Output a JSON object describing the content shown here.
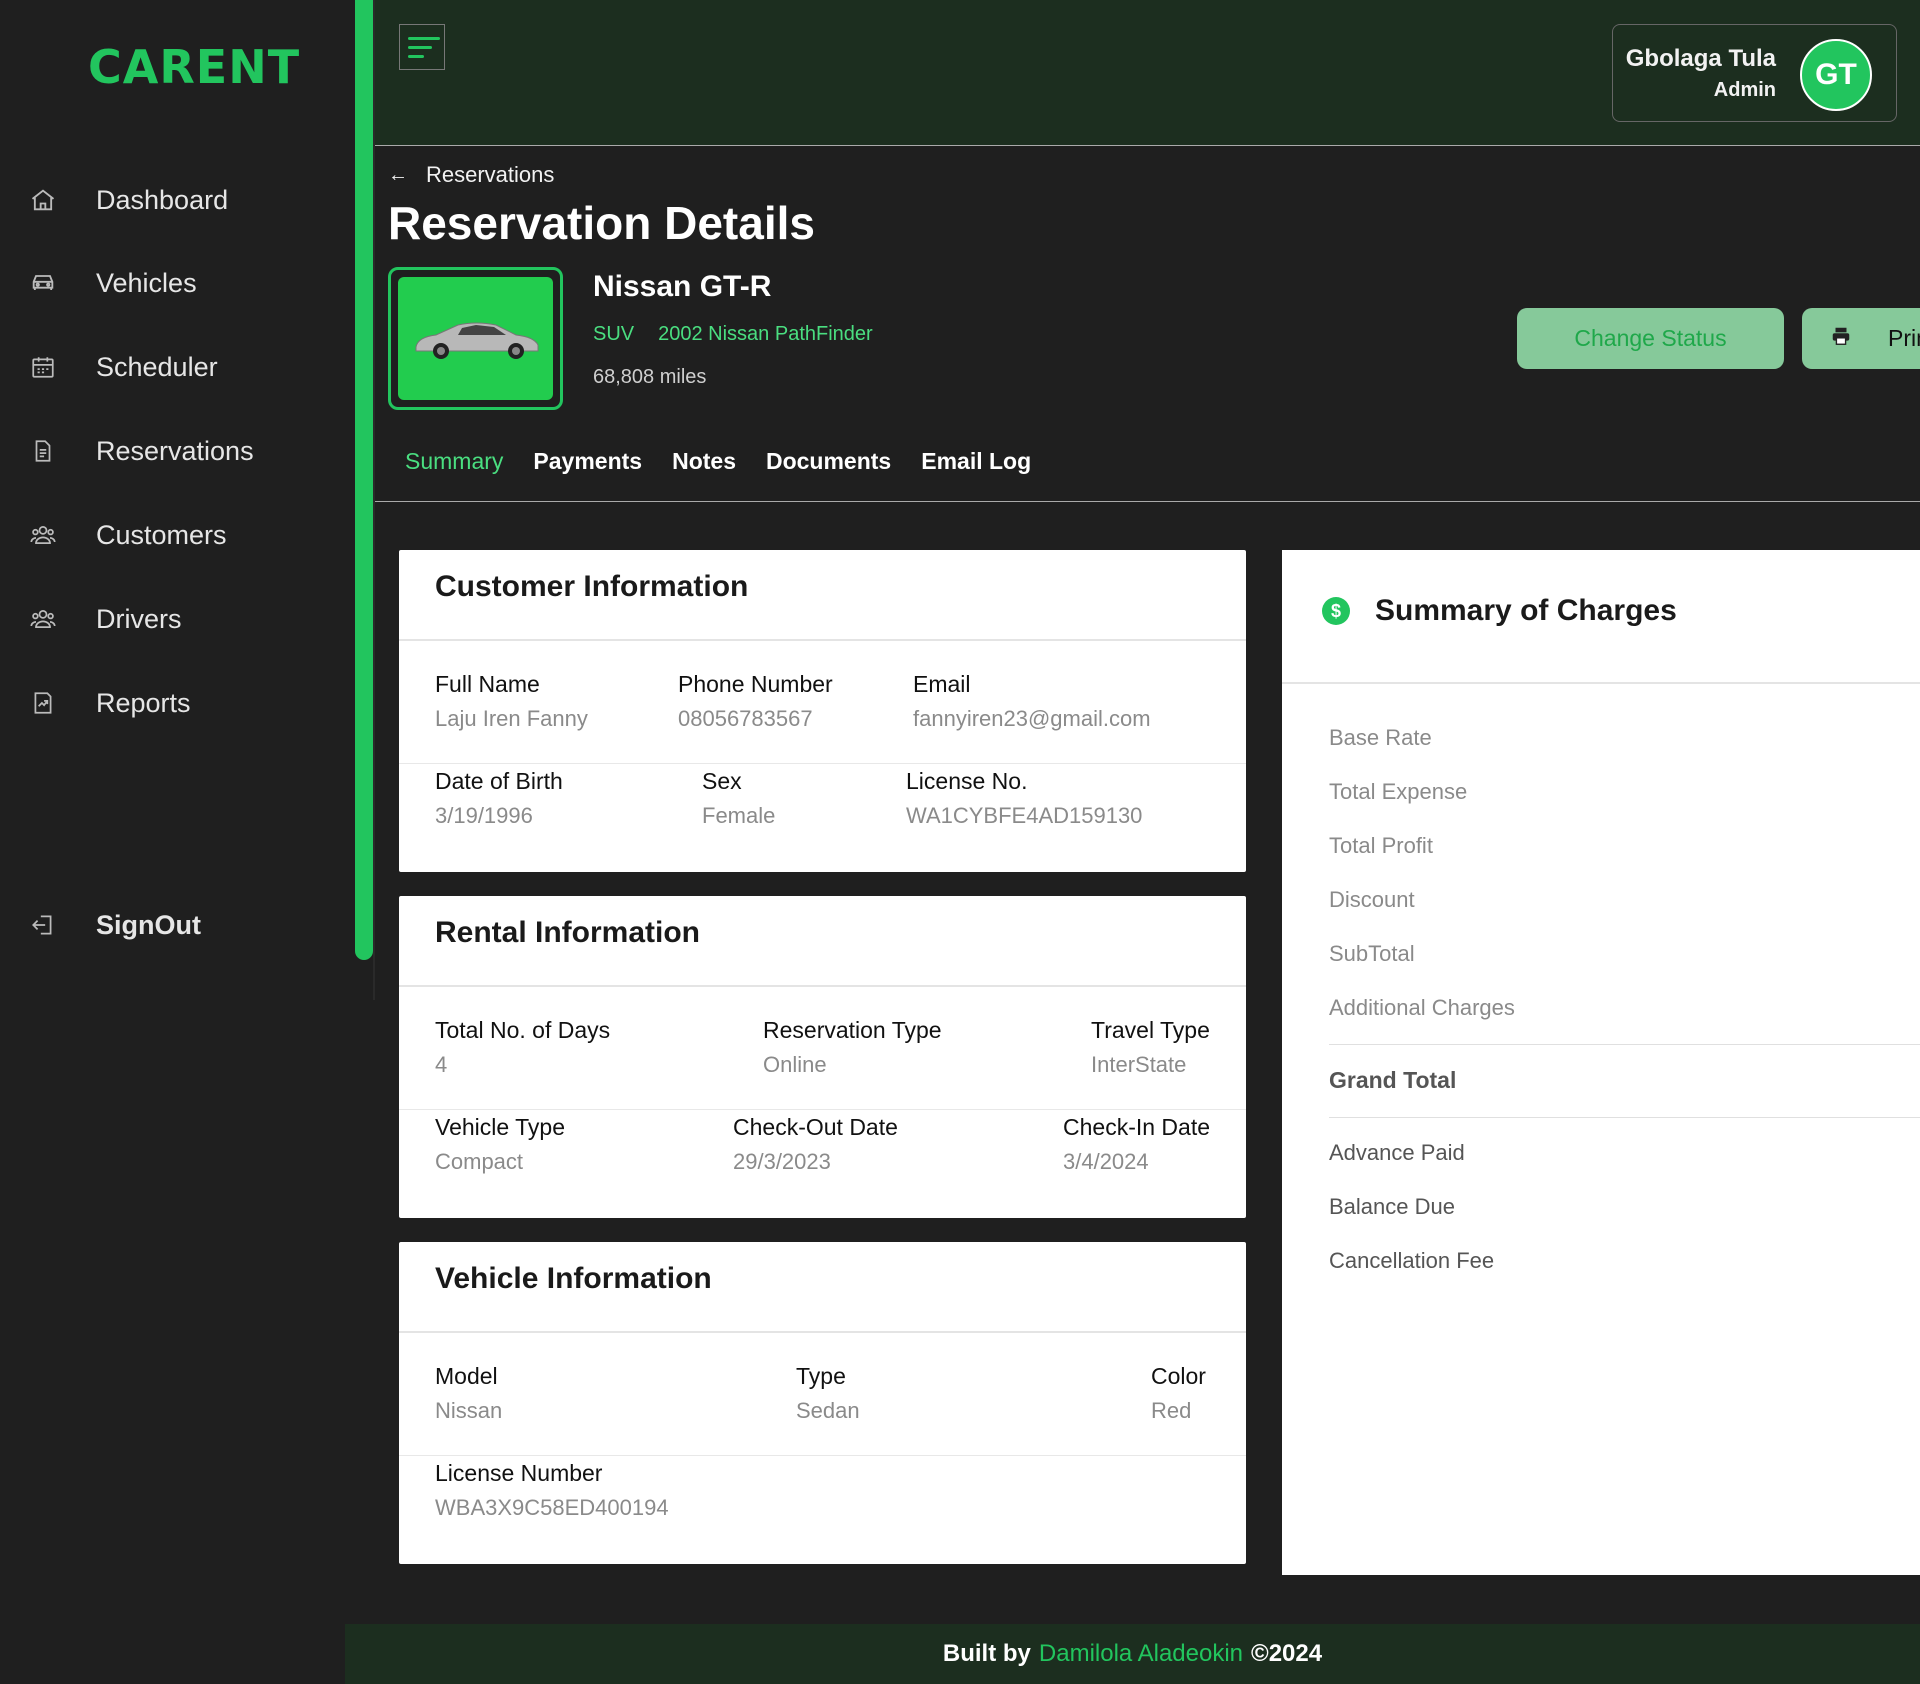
{
  "brand": {
    "logo": "CARENT",
    "accent": "#22c55e"
  },
  "sidebar": {
    "items": [
      {
        "label": "Dashboard",
        "icon": "home-icon"
      },
      {
        "label": "Vehicles",
        "icon": "car-icon"
      },
      {
        "label": "Scheduler",
        "icon": "calendar-icon"
      },
      {
        "label": "Reservations",
        "icon": "document-icon"
      },
      {
        "label": "Customers",
        "icon": "users-icon"
      },
      {
        "label": "Drivers",
        "icon": "users-icon"
      },
      {
        "label": "Reports",
        "icon": "report-icon"
      }
    ],
    "signout": "SignOut"
  },
  "header": {
    "user_name": "Gbolaga Tula",
    "user_role": "Admin",
    "avatar_initials": "GT"
  },
  "page": {
    "breadcrumb": "Reservations",
    "title": "Reservation Details",
    "car": {
      "name": "Nissan GT-R",
      "type": "SUV",
      "model": "2002 Nissan PathFinder",
      "miles": "68,808 miles"
    },
    "buttons": {
      "change_status": "Change Status",
      "print": "Print"
    },
    "tabs": [
      "Summary",
      "Payments",
      "Notes",
      "Documents",
      "Email Log"
    ]
  },
  "customer": {
    "title": "Customer Information",
    "full_name_label": "Full Name",
    "full_name": "Laju Iren Fanny",
    "phone_label": "Phone Number",
    "phone": "08056783567",
    "email_label": "Email",
    "email": "fannyiren23@gmail.com",
    "dob_label": "Date of Birth",
    "dob": "3/19/1996",
    "sex_label": "Sex",
    "sex": "Female",
    "license_label": "License No.",
    "license": "WA1CYBFE4AD159130"
  },
  "rental": {
    "title": "Rental Information",
    "days_label": "Total No. of Days",
    "days": "4",
    "res_type_label": "Reservation Type",
    "res_type": "Online",
    "travel_label": "Travel Type",
    "travel": "InterState",
    "vehicle_type_label": "Vehicle Type",
    "vehicle_type": "Compact",
    "checkout_label": "Check-Out Date",
    "checkout": "29/3/2023",
    "checkin_label": "Check-In Date",
    "checkin": "3/4/2024"
  },
  "vehicle": {
    "title": "Vehicle Information",
    "model_label": "Model",
    "model": "Nissan",
    "type_label": "Type",
    "type": "Sedan",
    "color_label": "Color",
    "color": "Red",
    "plate_label": "License Number",
    "plate": "WBA3X9C58ED400194"
  },
  "charges": {
    "title": "Summary of Charges",
    "items": [
      "Base Rate",
      "Total Expense",
      "Total Profit",
      "Discount",
      "SubTotal",
      "Additional Charges"
    ],
    "grand_total": "Grand Total",
    "after": [
      "Advance Paid",
      "Balance Due",
      "Cancellation Fee"
    ]
  },
  "footer": {
    "prefix": "Built by",
    "author": "Damilola Aladeokin",
    "suffix": "©2024"
  }
}
